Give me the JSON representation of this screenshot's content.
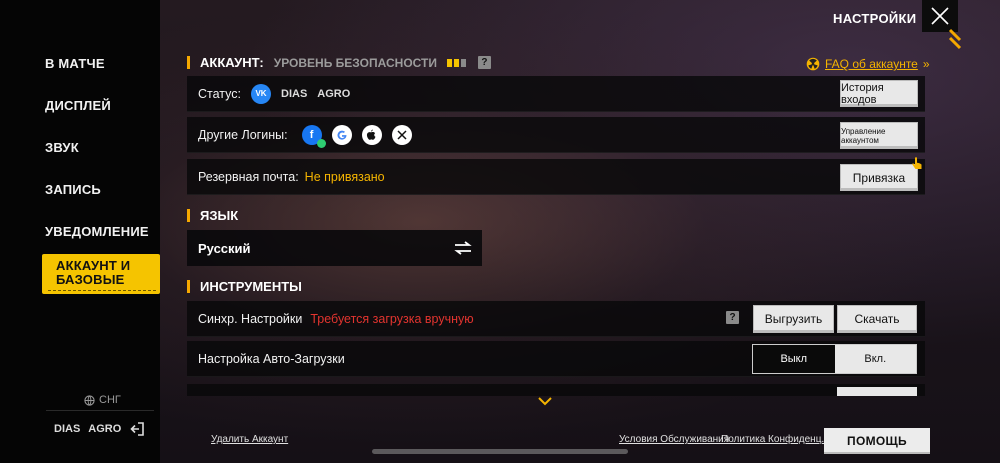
{
  "sidebar": {
    "items": [
      {
        "label": "В МАТЧЕ"
      },
      {
        "label": "ДИСПЛЕЙ"
      },
      {
        "label": "ЗВУК"
      },
      {
        "label": "ЗАПИСЬ"
      },
      {
        "label": "УВЕДОМЛЕНИЕ"
      },
      {
        "label_line1": "АККАУНТ И",
        "label_line2": "БАЗОВЫЕ",
        "active": true
      }
    ],
    "region": "СНГ",
    "user": {
      "part1": "DIAS",
      "part2": "AGRO"
    }
  },
  "header": {
    "title": "НАСТРОЙКИ"
  },
  "account": {
    "section_title": "АККАУНТ:",
    "security_label": "УРОВЕНЬ БЕЗОПАСНОСТИ",
    "security_level": 2,
    "security_max": 3,
    "faq_label": "FAQ об аккаунте",
    "status_label": "Статус:",
    "status_platform": "VK",
    "status_name1": "DIAS",
    "status_name2": "AGRO",
    "login_history_button": "История входов",
    "other_logins_label": "Другие Логины:",
    "manage_account_button": "Управление аккаунтом",
    "backup_mail_label": "Резервная почта:",
    "backup_mail_value": "Не привязано",
    "bind_button": "Привязка"
  },
  "language": {
    "section_title": "ЯЗЫК",
    "current": "Русский"
  },
  "tools": {
    "section_title": "ИНСТРУМЕНТЫ",
    "sync_label": "Синхр. Настройки",
    "sync_status": "Требуется загрузка вручную",
    "upload_button": "Выгрузить",
    "download_button": "Скачать",
    "autoload_label": "Настройка Авто-Загрузки",
    "toggle_off": "Выкл",
    "toggle_on": "Вкл.",
    "toggle_selected": "Выкл"
  },
  "footer": {
    "delete_account": "Удалить Аккаунт",
    "terms": "Условия Обслуживания",
    "privacy": "Политика Конфиденц.",
    "help_button": "ПОМОЩЬ"
  },
  "colors": {
    "accent": "#f5c400",
    "warning": "#f5b400",
    "error": "#e3342f",
    "vk": "#2787f5"
  }
}
